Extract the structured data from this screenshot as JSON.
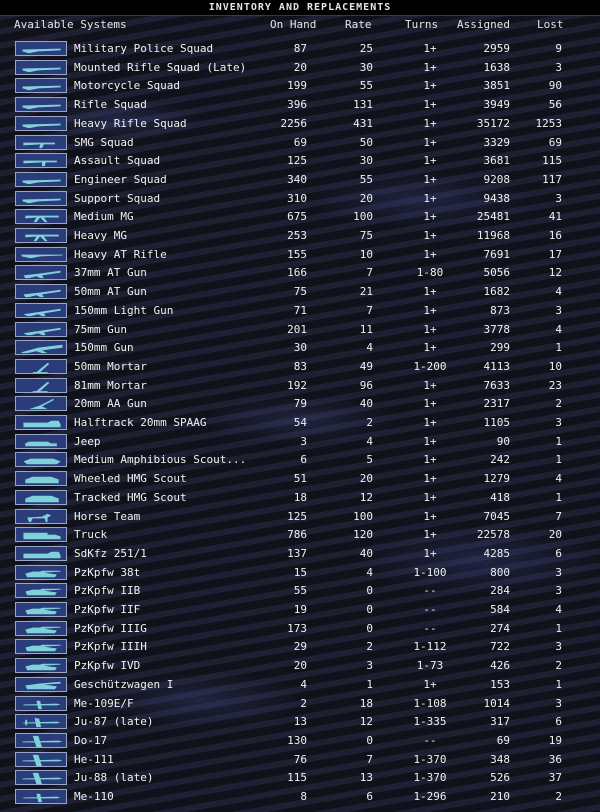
{
  "window": {
    "title": "INVENTORY AND REPLACEMENTS"
  },
  "columns": {
    "name": "Available Systems",
    "on_hand": "On Hand",
    "rate": "Rate",
    "turns": "Turns",
    "assigned": "Assigned",
    "lost": "Lost"
  },
  "colors": {
    "icon_bg": "#2a3c7a",
    "icon_fg": "#7fd1d8",
    "text": "#f2f2f2"
  },
  "rows": [
    {
      "icon": "rifle-icon",
      "name": "Military Police Squad",
      "on_hand": "87",
      "rate": "25",
      "turns": "1+",
      "assigned": "2959",
      "lost": "9"
    },
    {
      "icon": "rifle-icon",
      "name": "Mounted Rifle Squad (Late)",
      "on_hand": "20",
      "rate": "30",
      "turns": "1+",
      "assigned": "1638",
      "lost": "3"
    },
    {
      "icon": "rifle-icon",
      "name": "Motorcycle Squad",
      "on_hand": "199",
      "rate": "55",
      "turns": "1+",
      "assigned": "3851",
      "lost": "90"
    },
    {
      "icon": "rifle-icon",
      "name": "Rifle Squad",
      "on_hand": "396",
      "rate": "131",
      "turns": "1+",
      "assigned": "3949",
      "lost": "56"
    },
    {
      "icon": "rifle-icon",
      "name": "Heavy Rifle Squad",
      "on_hand": "2256",
      "rate": "431",
      "turns": "1+",
      "assigned": "35172",
      "lost": "1253"
    },
    {
      "icon": "smg-icon",
      "name": "SMG Squad",
      "on_hand": "69",
      "rate": "50",
      "turns": "1+",
      "assigned": "3329",
      "lost": "69"
    },
    {
      "icon": "assault-rifle-icon",
      "name": "Assault Squad",
      "on_hand": "125",
      "rate": "30",
      "turns": "1+",
      "assigned": "3681",
      "lost": "115"
    },
    {
      "icon": "rifle-icon",
      "name": "Engineer Squad",
      "on_hand": "340",
      "rate": "55",
      "turns": "1+",
      "assigned": "9208",
      "lost": "117"
    },
    {
      "icon": "rifle-icon",
      "name": "Support Squad",
      "on_hand": "310",
      "rate": "20",
      "turns": "1+",
      "assigned": "9438",
      "lost": "3"
    },
    {
      "icon": "machine-gun-icon",
      "name": "Medium MG",
      "on_hand": "675",
      "rate": "100",
      "turns": "1+",
      "assigned": "25481",
      "lost": "41"
    },
    {
      "icon": "machine-gun-icon",
      "name": "Heavy MG",
      "on_hand": "253",
      "rate": "75",
      "turns": "1+",
      "assigned": "11968",
      "lost": "16"
    },
    {
      "icon": "at-rifle-icon",
      "name": "Heavy AT Rifle",
      "on_hand": "155",
      "rate": "10",
      "turns": "1+",
      "assigned": "7691",
      "lost": "17"
    },
    {
      "icon": "at-gun-icon",
      "name": "37mm AT Gun",
      "on_hand": "166",
      "rate": "7",
      "turns": "1-80",
      "assigned": "5056",
      "lost": "12"
    },
    {
      "icon": "at-gun-icon",
      "name": "50mm AT Gun",
      "on_hand": "75",
      "rate": "21",
      "turns": "1+",
      "assigned": "1682",
      "lost": "4"
    },
    {
      "icon": "field-gun-icon",
      "name": "150mm Light Gun",
      "on_hand": "71",
      "rate": "7",
      "turns": "1+",
      "assigned": "873",
      "lost": "3"
    },
    {
      "icon": "field-gun-icon",
      "name": "75mm Gun",
      "on_hand": "201",
      "rate": "11",
      "turns": "1+",
      "assigned": "3778",
      "lost": "4"
    },
    {
      "icon": "heavy-gun-icon",
      "name": "150mm Gun",
      "on_hand": "30",
      "rate": "4",
      "turns": "1+",
      "assigned": "299",
      "lost": "1"
    },
    {
      "icon": "mortar-icon",
      "name": "50mm Mortar",
      "on_hand": "83",
      "rate": "49",
      "turns": "1-200",
      "assigned": "4113",
      "lost": "10"
    },
    {
      "icon": "mortar-icon",
      "name": "81mm Mortar",
      "on_hand": "192",
      "rate": "96",
      "turns": "1+",
      "assigned": "7633",
      "lost": "23"
    },
    {
      "icon": "aa-gun-icon",
      "name": "20mm AA Gun",
      "on_hand": "79",
      "rate": "40",
      "turns": "1+",
      "assigned": "2317",
      "lost": "2"
    },
    {
      "icon": "halftrack-icon",
      "name": "Halftrack 20mm SPAAG",
      "on_hand": "54",
      "rate": "2",
      "turns": "1+",
      "assigned": "1105",
      "lost": "3"
    },
    {
      "icon": "jeep-icon",
      "name": "Jeep",
      "on_hand": "3",
      "rate": "4",
      "turns": "1+",
      "assigned": "90",
      "lost": "1"
    },
    {
      "icon": "amphibious-vehicle-icon",
      "name": "Medium Amphibious Scout...",
      "on_hand": "6",
      "rate": "5",
      "turns": "1+",
      "assigned": "242",
      "lost": "1"
    },
    {
      "icon": "scout-car-icon",
      "name": "Wheeled HMG Scout",
      "on_hand": "51",
      "rate": "20",
      "turns": "1+",
      "assigned": "1279",
      "lost": "4"
    },
    {
      "icon": "scout-car-icon",
      "name": "Tracked HMG Scout",
      "on_hand": "18",
      "rate": "12",
      "turns": "1+",
      "assigned": "418",
      "lost": "1"
    },
    {
      "icon": "horse-icon",
      "name": "Horse Team",
      "on_hand": "125",
      "rate": "100",
      "turns": "1+",
      "assigned": "7045",
      "lost": "7"
    },
    {
      "icon": "truck-icon",
      "name": "Truck",
      "on_hand": "786",
      "rate": "120",
      "turns": "1+",
      "assigned": "22578",
      "lost": "20"
    },
    {
      "icon": "halftrack-icon",
      "name": "SdKfz 251/1",
      "on_hand": "137",
      "rate": "40",
      "turns": "1+",
      "assigned": "4285",
      "lost": "6"
    },
    {
      "icon": "tank-icon",
      "name": "PzKpfw 38t",
      "on_hand": "15",
      "rate": "4",
      "turns": "1-100",
      "assigned": "800",
      "lost": "3"
    },
    {
      "icon": "tank-icon",
      "name": "PzKpfw IIB",
      "on_hand": "55",
      "rate": "0",
      "turns": "--",
      "assigned": "284",
      "lost": "3"
    },
    {
      "icon": "tank-icon",
      "name": "PzKpfw IIF",
      "on_hand": "19",
      "rate": "0",
      "turns": "--",
      "assigned": "584",
      "lost": "4"
    },
    {
      "icon": "tank-icon",
      "name": "PzKpfw IIIG",
      "on_hand": "173",
      "rate": "0",
      "turns": "--",
      "assigned": "274",
      "lost": "1"
    },
    {
      "icon": "tank-icon",
      "name": "PzKpfw IIIH",
      "on_hand": "29",
      "rate": "2",
      "turns": "1-112",
      "assigned": "722",
      "lost": "3"
    },
    {
      "icon": "tank-icon",
      "name": "PzKpfw IVD",
      "on_hand": "20",
      "rate": "3",
      "turns": "1-73",
      "assigned": "426",
      "lost": "2"
    },
    {
      "icon": "self-propelled-gun-icon",
      "name": "Geschützwagen I",
      "on_hand": "4",
      "rate": "1",
      "turns": "1+",
      "assigned": "153",
      "lost": "1"
    },
    {
      "icon": "fighter-plane-icon",
      "name": "Me-109E/F",
      "on_hand": "2",
      "rate": "18",
      "turns": "1-108",
      "assigned": "1014",
      "lost": "3"
    },
    {
      "icon": "dive-bomber-icon",
      "name": "Ju-87 (late)",
      "on_hand": "13",
      "rate": "12",
      "turns": "1-335",
      "assigned": "317",
      "lost": "6"
    },
    {
      "icon": "bomber-plane-icon",
      "name": "Do-17",
      "on_hand": "130",
      "rate": "0",
      "turns": "--",
      "assigned": "69",
      "lost": "19"
    },
    {
      "icon": "bomber-plane-icon",
      "name": "He-111",
      "on_hand": "76",
      "rate": "7",
      "turns": "1-370",
      "assigned": "348",
      "lost": "36"
    },
    {
      "icon": "bomber-plane-icon",
      "name": "Ju-88 (late)",
      "on_hand": "115",
      "rate": "13",
      "turns": "1-370",
      "assigned": "526",
      "lost": "37"
    },
    {
      "icon": "fighter-plane-icon",
      "name": "Me-110",
      "on_hand": "8",
      "rate": "6",
      "turns": "1-296",
      "assigned": "210",
      "lost": "2"
    }
  ]
}
